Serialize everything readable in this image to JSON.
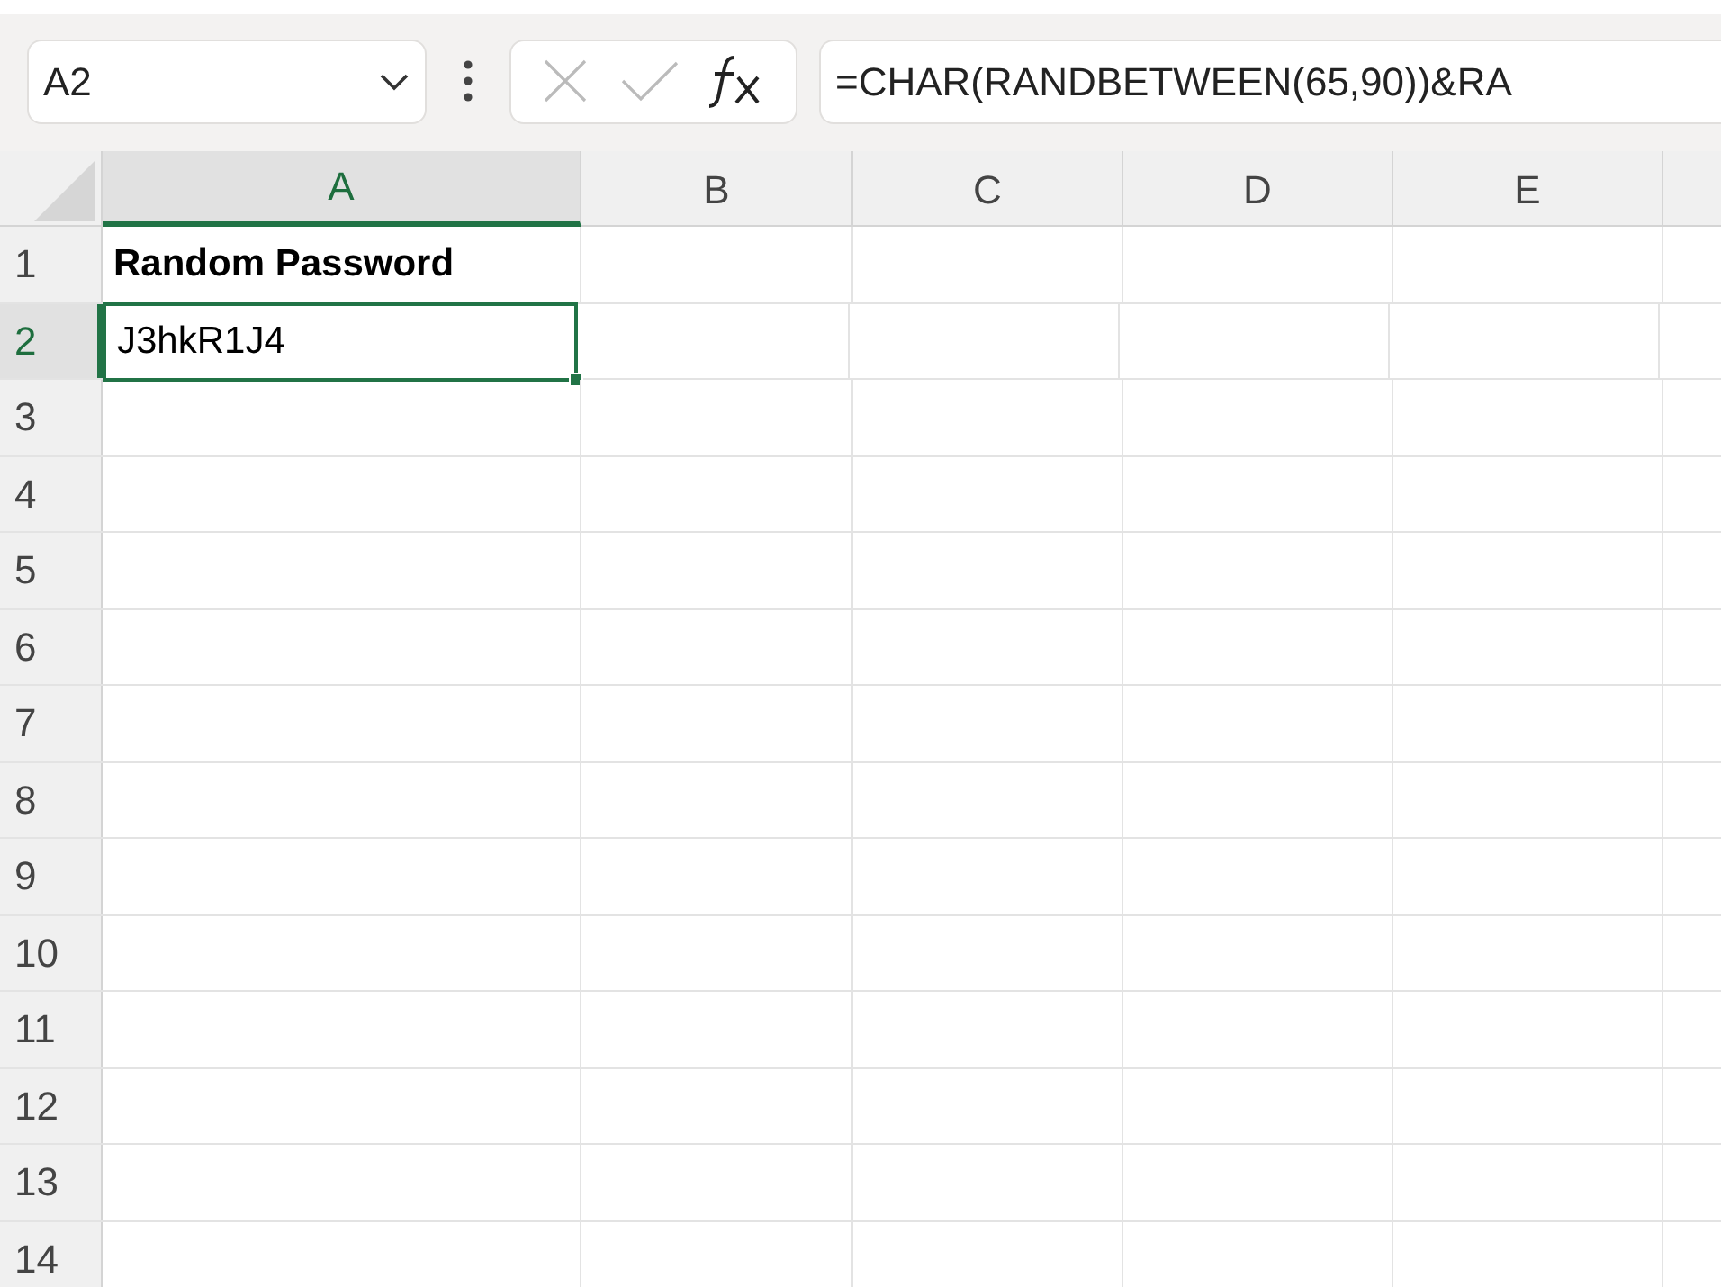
{
  "name_box": {
    "value": "A2"
  },
  "formula_bar": {
    "formula": "=CHAR(RANDBETWEEN(65,90))&RA"
  },
  "columns": [
    {
      "label": "A",
      "selected": true
    },
    {
      "label": "B",
      "selected": false
    },
    {
      "label": "C",
      "selected": false
    },
    {
      "label": "D",
      "selected": false
    },
    {
      "label": "E",
      "selected": false
    }
  ],
  "rows": [
    {
      "label": "1",
      "selected": false,
      "cells": [
        {
          "text": "Random Password",
          "bold": true,
          "selected": false
        }
      ]
    },
    {
      "label": "2",
      "selected": true,
      "cells": [
        {
          "text": "J3hkR1J4",
          "bold": false,
          "selected": true
        }
      ]
    },
    {
      "label": "3",
      "selected": false
    },
    {
      "label": "4",
      "selected": false
    },
    {
      "label": "5",
      "selected": false
    },
    {
      "label": "6",
      "selected": false
    },
    {
      "label": "7",
      "selected": false
    },
    {
      "label": "8",
      "selected": false
    },
    {
      "label": "9",
      "selected": false
    },
    {
      "label": "10",
      "selected": false
    },
    {
      "label": "11",
      "selected": false
    },
    {
      "label": "12",
      "selected": false
    },
    {
      "label": "13",
      "selected": false
    },
    {
      "label": "14",
      "selected": false
    }
  ]
}
